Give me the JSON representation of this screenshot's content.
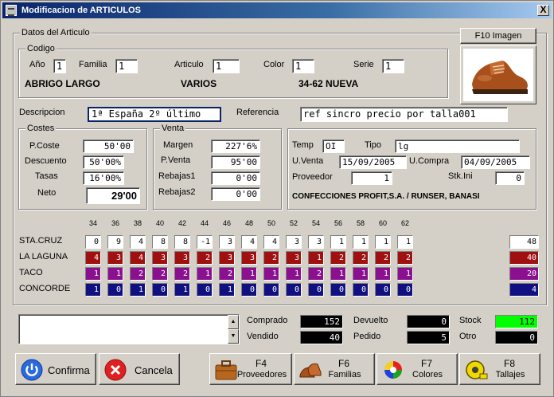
{
  "window": {
    "title": "Modificacion de ARTICULOS",
    "close_label": "X"
  },
  "article": {
    "group_label": "Datos del Articulo",
    "image_button": "F10 Imagen",
    "codigo": {
      "group_label": "Codigo",
      "ano_label": "Año",
      "ano_value": "1",
      "familia_label": "Familia",
      "familia_value": "1",
      "articulo_label": "Articulo",
      "articulo_value": "1",
      "color_label": "Color",
      "color_value": "1",
      "serie_label": "Serie",
      "serie_value": "1",
      "familia_name": "ABRIGO LARGO",
      "articulo_name": "VARIOS",
      "serie_name": "34-62 NUEVA"
    },
    "descripcion_label": "Descripcion",
    "descripcion_value": "1ª España 2º último",
    "referencia_label": "Referencia",
    "referencia_value": "ref sincro precio por talla001"
  },
  "costes": {
    "group_label": "Costes",
    "pcoste_label": "P.Coste",
    "pcoste_value": "50'00",
    "descuento_label": "Descuento",
    "descuento_value": "50'00%",
    "tasas_label": "Tasas",
    "tasas_value": "16'00%",
    "neto_label": "Neto",
    "neto_value": "29'00"
  },
  "venta": {
    "group_label": "Venta",
    "margen_label": "Margen",
    "margen_value": "227'6%",
    "pventa_label": "P.Venta",
    "pventa_value": "95'00",
    "rebajas1_label": "Rebajas1",
    "rebajas1_value": "0'00",
    "rebajas2_label": "Rebajas2",
    "rebajas2_value": "0'00"
  },
  "info": {
    "temp_label": "Temp",
    "temp_value": "OI",
    "tipo_label": "Tipo",
    "tipo_value": "lg",
    "uventa_label": "U.Venta",
    "uventa_value": "15/09/2005",
    "ucompra_label": "U.Compra",
    "ucompra_value": "04/09/2005",
    "proveedor_label": "Proveedor",
    "proveedor_value": "1",
    "stkini_label": "Stk.Ini",
    "stkini_value": "0",
    "proveedor_name": "CONFECCIONES PROFIT,S.A. / RUNSER, BANASI"
  },
  "sizes": [
    "34",
    "36",
    "38",
    "40",
    "42",
    "44",
    "46",
    "48",
    "50",
    "52",
    "54",
    "56",
    "58",
    "60",
    "62"
  ],
  "stores": [
    {
      "name": "STA.CRUZ",
      "bg": "#ffffff",
      "fg": "#000000",
      "values": [
        "0",
        "9",
        "4",
        "8",
        "8",
        "-1",
        "3",
        "4",
        "4",
        "3",
        "3",
        "1",
        "1",
        "1",
        "1"
      ],
      "total": "48"
    },
    {
      "name": "LA LAGUNA",
      "bg": "#a01010",
      "fg": "#ffffff",
      "values": [
        "4",
        "3",
        "4",
        "3",
        "3",
        "2",
        "3",
        "3",
        "2",
        "3",
        "1",
        "2",
        "2",
        "2",
        "2"
      ],
      "total": "40"
    },
    {
      "name": "TACO",
      "bg": "#8a1090",
      "fg": "#ffffff",
      "values": [
        "1",
        "1",
        "2",
        "2",
        "2",
        "1",
        "2",
        "1",
        "1",
        "1",
        "2",
        "1",
        "1",
        "1",
        "1"
      ],
      "total": "20"
    },
    {
      "name": "CONCORDE",
      "bg": "#101080",
      "fg": "#ffffff",
      "values": [
        "1",
        "0",
        "1",
        "0",
        "1",
        "0",
        "1",
        "0",
        "0",
        "0",
        "0",
        "0",
        "0",
        "0",
        "0"
      ],
      "total": "4"
    }
  ],
  "summary": {
    "comprado_label": "Comprado",
    "comprado_value": "152",
    "vendido_label": "Vendido",
    "vendido_value": "40",
    "devuelto_label": "Devuelto",
    "devuelto_value": "0",
    "pedido_label": "Pedido",
    "pedido_value": "5",
    "stock_label": "Stock",
    "stock_value": "112",
    "otro_label": "Otro",
    "otro_value": "0",
    "stock_color": "#00ff00"
  },
  "buttons": {
    "confirma": "Confirma",
    "cancela": "Cancela",
    "f4_key": "F4",
    "f4_label": "Proveedores",
    "f6_key": "F6",
    "f6_label": "Familias",
    "f7_key": "F7",
    "f7_label": "Colores",
    "f8_key": "F8",
    "f8_label": "Tallajes"
  }
}
